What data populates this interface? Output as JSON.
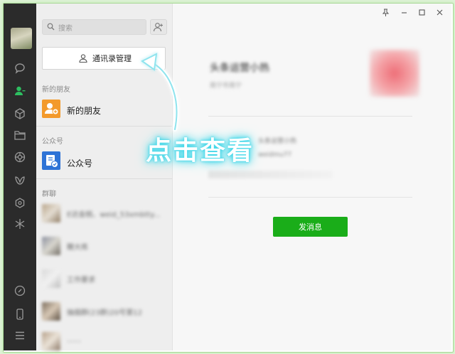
{
  "sidebar": {
    "avatar": "user-avatar",
    "icons": [
      "chat-icon",
      "contacts-icon",
      "favorites-cube-icon",
      "folder-icon",
      "moments-icon",
      "channels-icon",
      "mini-program-icon",
      "star-icon",
      "link-icon",
      "phone-icon",
      "menu-icon"
    ]
  },
  "search": {
    "placeholder": "搜索"
  },
  "contacts_manage": {
    "label": "通讯录管理"
  },
  "sections": {
    "new_friends_header": "新的朋友",
    "new_friends_item": "新的朋友",
    "official_header": "公众号",
    "official_item": "公众号",
    "groups_header": "群聊"
  },
  "groups": [
    {
      "name": "E达金桃、weid_53xmbtty..."
    },
    {
      "name": "鞭大练"
    },
    {
      "name": "工作要求"
    },
    {
      "name": "抽烟群(23群)20号第12"
    },
    {
      "name": "……"
    }
  ],
  "profile": {
    "name": "头条运营小热",
    "subtitle": "南宁市南宁"
  },
  "info": [
    "头条运营小热",
    "weidmu77"
  ],
  "actions": {
    "send_message": "发消息"
  },
  "annotation": {
    "text": "点击查看"
  },
  "colors": {
    "accent": "#1aad19",
    "rail": "#2b2b2b",
    "glow": "#3dd6e8"
  }
}
